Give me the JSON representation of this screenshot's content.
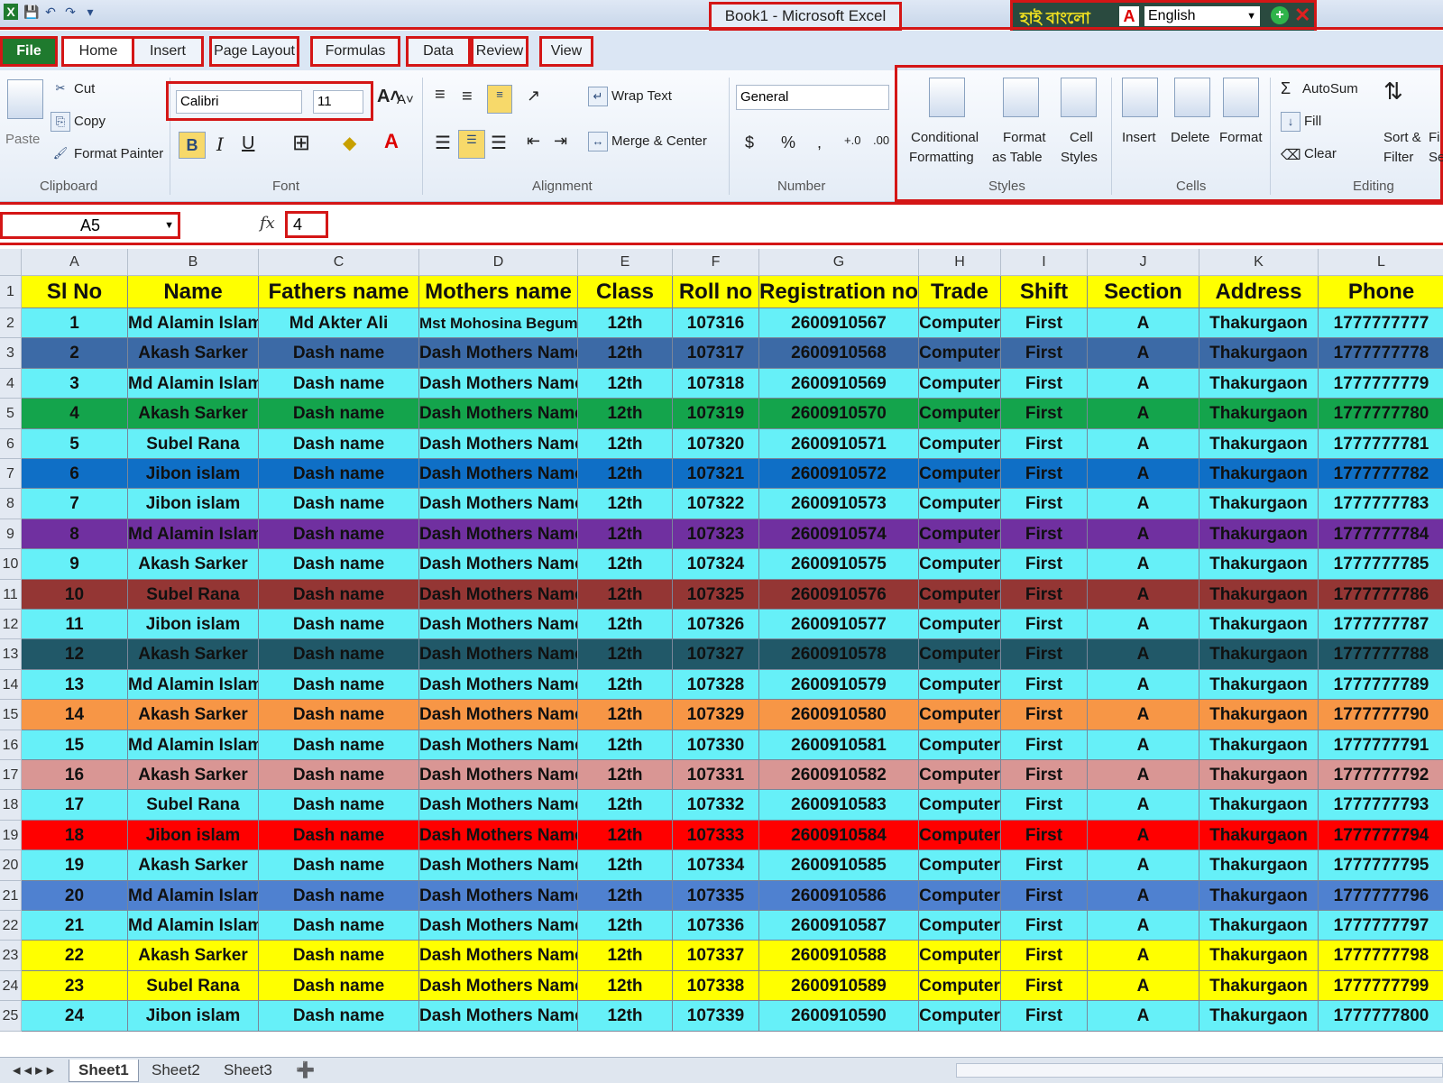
{
  "window": {
    "title": "Book1  -  Microsoft Excel",
    "lang_bengali": "হাই বাংলো",
    "lang_selected": "English"
  },
  "tabs": [
    "File",
    "Home",
    "Insert",
    "Page Layout",
    "Formulas",
    "Data",
    "Review",
    "View"
  ],
  "ribbon": {
    "clipboard": {
      "paste": "Paste",
      "cut": "Cut",
      "copy": "Copy",
      "format_painter": "Format Painter",
      "label": "Clipboard"
    },
    "font": {
      "name": "Calibri",
      "size": "11",
      "label": "Font"
    },
    "alignment": {
      "wrap": "Wrap Text",
      "merge": "Merge & Center",
      "label": "Alignment"
    },
    "number": {
      "format": "General",
      "label": "Number"
    },
    "styles": {
      "conditional1": "Conditional",
      "conditional2": "Formatting",
      "table1": "Format",
      "table2": "as Table",
      "cell1": "Cell",
      "cell2": "Styles",
      "label": "Styles"
    },
    "cells": {
      "insert": "Insert",
      "delete": "Delete",
      "format": "Format",
      "label": "Cells"
    },
    "editing": {
      "autosum": "AutoSum",
      "fill": "Fill",
      "clear": "Clear",
      "sort1": "Sort &",
      "sort2": "Filter",
      "find1": "Fi",
      "find2": "Se",
      "label": "Editing"
    }
  },
  "formula_bar": {
    "name_box": "A5",
    "fx": "fx",
    "value": "4"
  },
  "columns": [
    "A",
    "B",
    "C",
    "D",
    "E",
    "F",
    "G",
    "H",
    "I",
    "J",
    "K",
    "L"
  ],
  "header_row": [
    "Sl No",
    "Name",
    "Fathers name",
    "Mothers name",
    "Class",
    "Roll no",
    "Registration no",
    "Trade",
    "Shift",
    "Section",
    "Address",
    "Phone"
  ],
  "rows": [
    {
      "color": "#66f0f8",
      "cells": [
        "1",
        "Md Alamin Islam",
        "Md Akter Ali",
        "Mst Mohosina Begum",
        "12th",
        "107316",
        "2600910567",
        "Computer",
        "First",
        "A",
        "Thakurgaon",
        "1777777777"
      ]
    },
    {
      "color": "#3c6aa6",
      "cells": [
        "2",
        "Akash Sarker",
        "Dash name",
        "Dash Mothers Name",
        "12th",
        "107317",
        "2600910568",
        "Computer",
        "First",
        "A",
        "Thakurgaon",
        "1777777778"
      ]
    },
    {
      "color": "#66f0f8",
      "cells": [
        "3",
        "Md Alamin Islam",
        "Dash name",
        "Dash Mothers Name",
        "12th",
        "107318",
        "2600910569",
        "Computer",
        "First",
        "A",
        "Thakurgaon",
        "1777777779"
      ]
    },
    {
      "color": "#14a44c",
      "cells": [
        "4",
        "Akash Sarker",
        "Dash name",
        "Dash Mothers Name",
        "12th",
        "107319",
        "2600910570",
        "Computer",
        "First",
        "A",
        "Thakurgaon",
        "1777777780"
      ]
    },
    {
      "color": "#66f0f8",
      "cells": [
        "5",
        "Subel Rana",
        "Dash name",
        "Dash Mothers Name",
        "12th",
        "107320",
        "2600910571",
        "Computer",
        "First",
        "A",
        "Thakurgaon",
        "1777777781"
      ]
    },
    {
      "color": "#0f6fc6",
      "cells": [
        "6",
        "Jibon islam",
        "Dash name",
        "Dash Mothers Name",
        "12th",
        "107321",
        "2600910572",
        "Computer",
        "First",
        "A",
        "Thakurgaon",
        "1777777782"
      ]
    },
    {
      "color": "#66f0f8",
      "cells": [
        "7",
        "Jibon islam",
        "Dash name",
        "Dash Mothers Name",
        "12th",
        "107322",
        "2600910573",
        "Computer",
        "First",
        "A",
        "Thakurgaon",
        "1777777783"
      ]
    },
    {
      "color": "#7030a0",
      "cells": [
        "8",
        "Md Alamin Islam",
        "Dash name",
        "Dash Mothers Name",
        "12th",
        "107323",
        "2600910574",
        "Computer",
        "First",
        "A",
        "Thakurgaon",
        "1777777784"
      ]
    },
    {
      "color": "#66f0f8",
      "cells": [
        "9",
        "Akash Sarker",
        "Dash name",
        "Dash Mothers Name",
        "12th",
        "107324",
        "2600910575",
        "Computer",
        "First",
        "A",
        "Thakurgaon",
        "1777777785"
      ]
    },
    {
      "color": "#943634",
      "cells": [
        "10",
        "Subel Rana",
        "Dash name",
        "Dash Mothers Name",
        "12th",
        "107325",
        "2600910576",
        "Computer",
        "First",
        "A",
        "Thakurgaon",
        "1777777786"
      ]
    },
    {
      "color": "#66f0f8",
      "cells": [
        "11",
        "Jibon islam",
        "Dash name",
        "Dash Mothers Name",
        "12th",
        "107326",
        "2600910577",
        "Computer",
        "First",
        "A",
        "Thakurgaon",
        "1777777787"
      ]
    },
    {
      "color": "#215868",
      "cells": [
        "12",
        "Akash Sarker",
        "Dash name",
        "Dash Mothers Name",
        "12th",
        "107327",
        "2600910578",
        "Computer",
        "First",
        "A",
        "Thakurgaon",
        "1777777788"
      ]
    },
    {
      "color": "#66f0f8",
      "cells": [
        "13",
        "Md Alamin Islam",
        "Dash name",
        "Dash Mothers Name",
        "12th",
        "107328",
        "2600910579",
        "Computer",
        "First",
        "A",
        "Thakurgaon",
        "1777777789"
      ]
    },
    {
      "color": "#f79646",
      "cells": [
        "14",
        "Akash Sarker",
        "Dash name",
        "Dash Mothers Name",
        "12th",
        "107329",
        "2600910580",
        "Computer",
        "First",
        "A",
        "Thakurgaon",
        "1777777790"
      ]
    },
    {
      "color": "#66f0f8",
      "cells": [
        "15",
        "Md Alamin Islam",
        "Dash name",
        "Dash Mothers Name",
        "12th",
        "107330",
        "2600910581",
        "Computer",
        "First",
        "A",
        "Thakurgaon",
        "1777777791"
      ]
    },
    {
      "color": "#d99694",
      "cells": [
        "16",
        "Akash Sarker",
        "Dash name",
        "Dash Mothers Name",
        "12th",
        "107331",
        "2600910582",
        "Computer",
        "First",
        "A",
        "Thakurgaon",
        "1777777792"
      ]
    },
    {
      "color": "#66f0f8",
      "cells": [
        "17",
        "Subel Rana",
        "Dash name",
        "Dash Mothers Name",
        "12th",
        "107332",
        "2600910583",
        "Computer",
        "First",
        "A",
        "Thakurgaon",
        "1777777793"
      ]
    },
    {
      "color": "#ff0000",
      "cells": [
        "18",
        "Jibon islam",
        "Dash name",
        "Dash Mothers Name",
        "12th",
        "107333",
        "2600910584",
        "Computer",
        "First",
        "A",
        "Thakurgaon",
        "1777777794"
      ]
    },
    {
      "color": "#66f0f8",
      "cells": [
        "19",
        "Akash Sarker",
        "Dash name",
        "Dash Mothers Name",
        "12th",
        "107334",
        "2600910585",
        "Computer",
        "First",
        "A",
        "Thakurgaon",
        "1777777795"
      ]
    },
    {
      "color": "#4f81d0",
      "cells": [
        "20",
        "Md Alamin Islam",
        "Dash name",
        "Dash Mothers Name",
        "12th",
        "107335",
        "2600910586",
        "Computer",
        "First",
        "A",
        "Thakurgaon",
        "1777777796"
      ]
    },
    {
      "color": "#66f0f8",
      "cells": [
        "21",
        "Md Alamin Islam",
        "Dash name",
        "Dash Mothers Name",
        "12th",
        "107336",
        "2600910587",
        "Computer",
        "First",
        "A",
        "Thakurgaon",
        "1777777797"
      ]
    },
    {
      "color": "#ffff00",
      "cells": [
        "22",
        "Akash Sarker",
        "Dash name",
        "Dash Mothers Name",
        "12th",
        "107337",
        "2600910588",
        "Computer",
        "First",
        "A",
        "Thakurgaon",
        "1777777798"
      ]
    },
    {
      "color": "#ffff00",
      "cells": [
        "23",
        "Subel Rana",
        "Dash name",
        "Dash Mothers Name",
        "12th",
        "107338",
        "2600910589",
        "Computer",
        "First",
        "A",
        "Thakurgaon",
        "1777777799"
      ]
    },
    {
      "color": "#66f0f8",
      "cells": [
        "24",
        "Jibon islam",
        "Dash name",
        "Dash Mothers Name",
        "12th",
        "107339",
        "2600910590",
        "Computer",
        "First",
        "A",
        "Thakurgaon",
        "1777777800"
      ]
    }
  ],
  "header_color": "#ffff00",
  "sheets": [
    "Sheet1",
    "Sheet2",
    "Sheet3"
  ],
  "accent_red": "#d41616"
}
